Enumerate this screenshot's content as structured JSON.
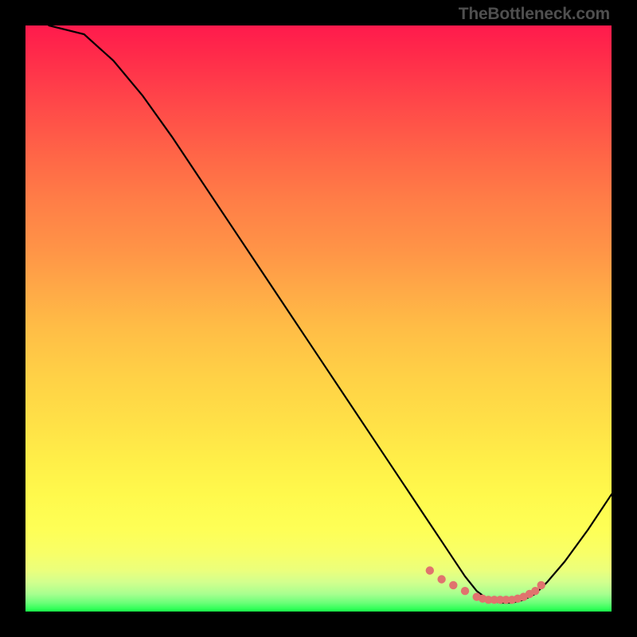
{
  "attribution": "TheBottleneck.com",
  "chart_data": {
    "type": "line",
    "title": "",
    "xlabel": "",
    "ylabel": "",
    "xlim": [
      0,
      100
    ],
    "ylim": [
      0,
      100
    ],
    "background_gradient_meaning": "Vertical gradient from red (high bottleneck) at top through orange and yellow to green (no bottleneck) at bottom.",
    "series": [
      {
        "name": "bottleneck-curve",
        "description": "V-shaped curve: bottleneck percentage vs component capability. Starts high at low x, descends to near-zero minimum around x≈79, then rises again.",
        "x": [
          4,
          10,
          15,
          20,
          25,
          30,
          35,
          40,
          45,
          50,
          55,
          60,
          65,
          68,
          71,
          73,
          75,
          77,
          79,
          81,
          83,
          85,
          87,
          89,
          92,
          96,
          100
        ],
        "values": [
          100,
          98.5,
          94,
          88,
          81,
          73.5,
          66,
          58.5,
          51,
          43.5,
          36,
          28.5,
          21,
          16.5,
          12,
          9,
          6,
          3.5,
          2,
          1.5,
          1.5,
          2,
          3,
          5,
          8.5,
          14,
          20
        ]
      },
      {
        "name": "low-bottleneck-region",
        "description": "Dotted salmon markers indicating the flat low-bottleneck zone around the curve minimum.",
        "x": [
          69,
          71,
          73,
          75,
          77,
          78,
          79,
          80,
          81,
          82,
          83,
          84,
          85,
          86,
          87,
          88
        ],
        "values": [
          7,
          5.5,
          4.5,
          3.5,
          2.5,
          2.2,
          2,
          2,
          2,
          2,
          2,
          2.2,
          2.5,
          3,
          3.5,
          4.5
        ]
      }
    ]
  },
  "colors": {
    "curve_stroke": "#000000",
    "marker_fill": "#e0736e",
    "gradient_top": "#ff1a4c",
    "gradient_bottom": "#18ff4a",
    "background": "#000000",
    "attribution_text": "#4f4f4f"
  }
}
